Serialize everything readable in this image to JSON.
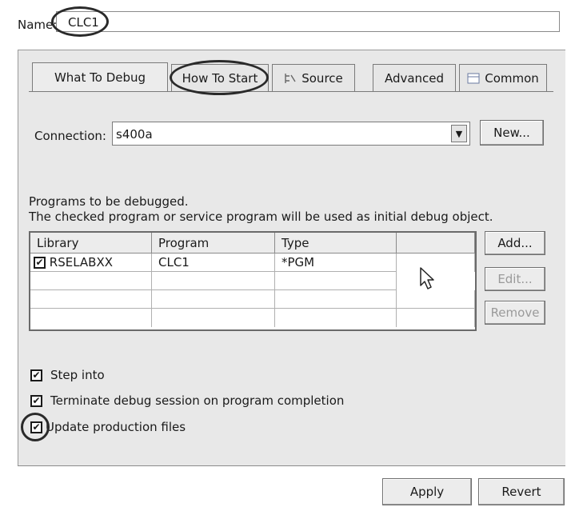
{
  "name": {
    "label": "Name:",
    "value": "CLC1"
  },
  "tabs": [
    {
      "label": "What To Debug"
    },
    {
      "label": "How To Start"
    },
    {
      "label": "Source"
    },
    {
      "label": "Advanced"
    },
    {
      "label": "Common"
    }
  ],
  "connection": {
    "label": "Connection:",
    "value": "s400a",
    "new_button": "New..."
  },
  "programs": {
    "desc1": "Programs to be debugged.",
    "desc2": "The checked program or service program will be used as initial debug object.",
    "columns": [
      "Library",
      "Program",
      "Type",
      ""
    ],
    "rows": [
      {
        "checked": true,
        "library": "RSELABXX",
        "program": "CLC1",
        "type": "*PGM"
      }
    ],
    "buttons": {
      "add": "Add...",
      "edit": "Edit...",
      "remove": "Remove"
    }
  },
  "options": [
    {
      "label": "Step into",
      "checked": true
    },
    {
      "label": "Terminate debug session on program completion",
      "checked": true
    },
    {
      "label": "Update production files",
      "checked": true
    }
  ],
  "footer": {
    "apply": "Apply",
    "revert": "Revert"
  },
  "icons": {
    "source_tab": "source-tree-icon",
    "common_tab": "table-icon",
    "cursor": "mouse-cursor-icon",
    "combo": "chevron-down-icon"
  }
}
